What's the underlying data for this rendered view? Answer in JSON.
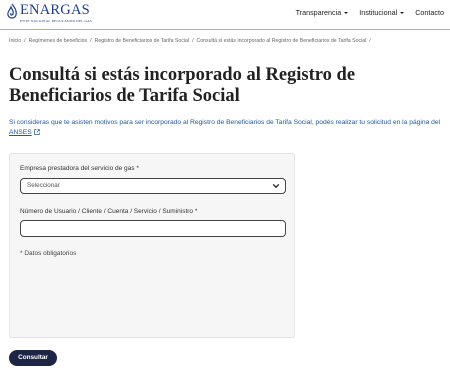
{
  "header": {
    "logo_text": "ENARGAS",
    "logo_subtitle": "ENTE NACIONAL REGULADOR DEL GAS",
    "nav": [
      {
        "label": "Transparencia"
      },
      {
        "label": "Institucional"
      },
      {
        "label": "Contacto"
      }
    ]
  },
  "breadcrumb": [
    "Inicio",
    "Regímenes de beneficios",
    "Registro de Beneficiarios de Tarifa Social",
    "Consultá si estás incorporado al Registro de Beneficiarios de Tarifa Social"
  ],
  "page": {
    "title": "Consultá si estás incorporado al Registro de Beneficiarios de Tarifa Social",
    "description": "Si consideras que te asisten motivos para ser incorporado al Registro de Beneficiarios de Tarifa Social, podés realizar tu solicitud en la página del",
    "link_label": "ANSES"
  },
  "form": {
    "company_label": "Empresa prestadora del servicio de gas *",
    "company_selected": "Seleccionar",
    "user_number_label": "Número de Usuario / Cliente / Cuenta / Servicio / Suministro *",
    "user_number_value": "",
    "required_note": "* Datos obligatorios",
    "submit_label": "Consultar"
  },
  "colors": {
    "brand_blue": "#1d3f8e",
    "link_blue": "#1d5aa6",
    "header_rule_gold": "#d8b13a",
    "button_navy": "#1d2546"
  }
}
